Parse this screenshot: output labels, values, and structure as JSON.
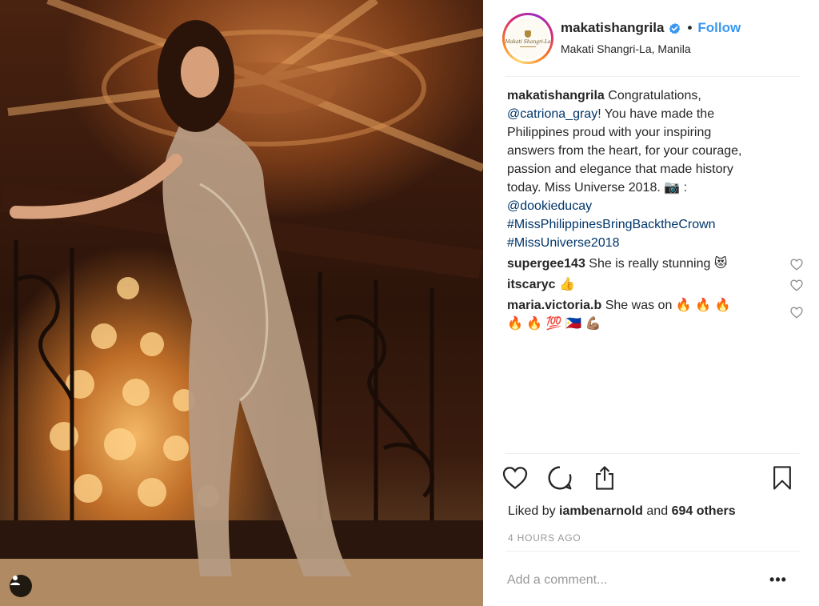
{
  "post": {
    "username": "makatishangrila",
    "follow_label": "Follow",
    "separator": "•",
    "location": "Makati Shangri-La, Manila",
    "avatar_text": "Makati Shangri-La"
  },
  "caption": {
    "username": "makatishangrila",
    "line1": "Congratulations,",
    "mention_catriona": "@catriona_gray",
    "line2_rest": "! You have made the",
    "line3": "Philippines proud with your inspiring",
    "line4": "answers from the heart, for your courage,",
    "line5": "passion and elegance that made history",
    "line6": "today. Miss Universe 2018. 📷 :",
    "mention_photographer": "@dookieducay",
    "hashtag1": "#MissPhilippinesBringBacktheCrown",
    "hashtag2": "#MissUniverse2018"
  },
  "comments": [
    {
      "username": "supergee143",
      "text": "She is really stunning 😻"
    },
    {
      "username": "itscaryc",
      "text": "👍"
    },
    {
      "username": "maria.victoria.b",
      "text": "She was on 🔥 🔥 🔥",
      "text2": "🔥 🔥 💯 🇵🇭 💪🏽"
    }
  ],
  "likes": {
    "prefix": "Liked by",
    "liker": "iambenarnold",
    "and_label": "and",
    "others": "694 others"
  },
  "timestamp": "4 HOURS AGO",
  "comment_box": {
    "placeholder": "Add a comment..."
  },
  "more_label": "•••",
  "colors": {
    "link_blue": "#3897f0",
    "tag_blue": "#003569",
    "muted_gray": "#999999",
    "divider": "#efefef"
  },
  "icons": [
    "verified-badge-icon",
    "heart-icon",
    "comment-icon",
    "share-icon",
    "bookmark-icon",
    "user-tag-icon",
    "more-options-icon"
  ]
}
